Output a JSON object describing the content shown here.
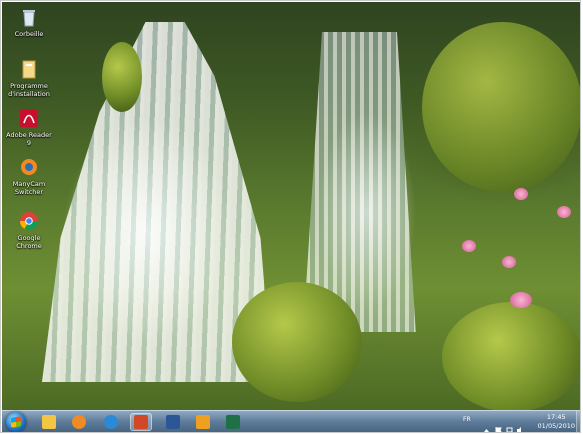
{
  "desktop": {
    "icons": [
      {
        "label": "Corbeille",
        "icon": "recycle-bin-icon"
      },
      {
        "label": "Programme d'installation",
        "icon": "installer-icon"
      },
      {
        "label": "Adobe Reader 9",
        "icon": "adobe-reader-icon"
      },
      {
        "label": "ManyCam Switcher",
        "icon": "manycam-icon"
      },
      {
        "label": "Google Chrome",
        "icon": "chrome-icon"
      }
    ]
  },
  "taskbar": {
    "pinned": [
      {
        "icon": "explorer-icon",
        "color": "#f2c545"
      },
      {
        "icon": "media-player-icon",
        "color": "#f08a24"
      },
      {
        "icon": "internet-explorer-icon",
        "color": "#2a8ad8"
      },
      {
        "icon": "powerpoint-icon",
        "color": "#d24726"
      },
      {
        "icon": "word-icon",
        "color": "#2b5797"
      },
      {
        "icon": "outlook-icon",
        "color": "#f0a020"
      },
      {
        "icon": "excel-icon",
        "color": "#1e7145"
      }
    ],
    "tray": {
      "language": "FR",
      "time": "17:45",
      "date": "01/05/2010"
    }
  }
}
